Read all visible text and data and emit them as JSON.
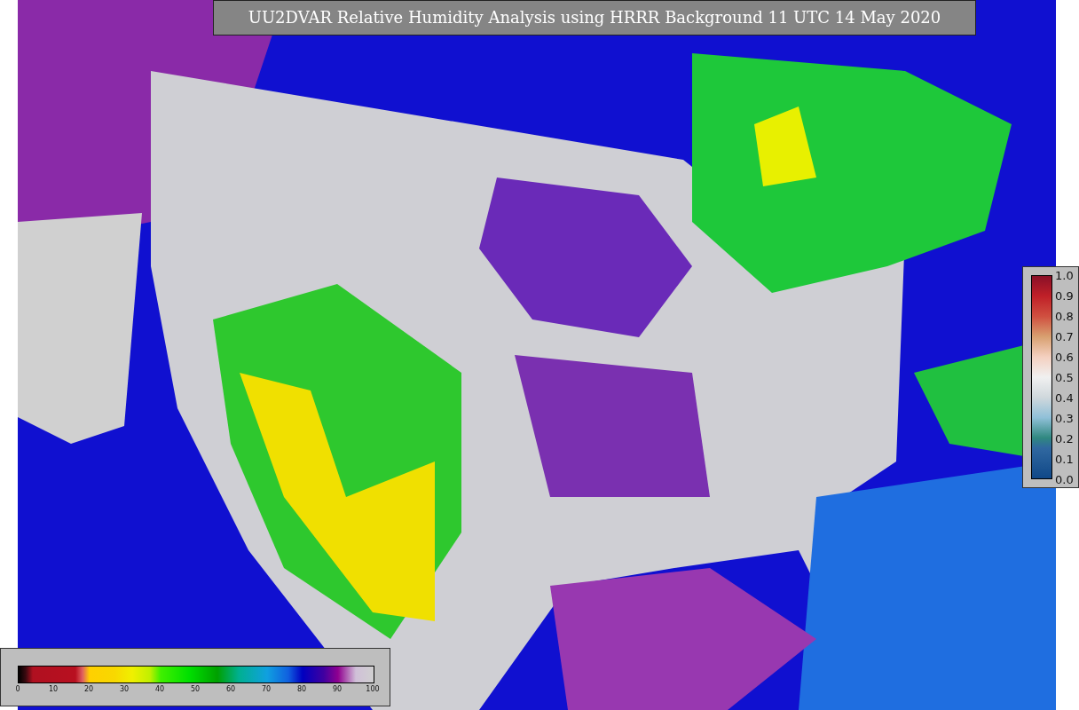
{
  "title": "UU2DVAR Relative Humidity Analysis using HRRR Background 11 UTC 14 May 2020",
  "humidity_colorbar": {
    "ticks": [
      "0",
      "10",
      "20",
      "30",
      "40",
      "50",
      "60",
      "70",
      "80",
      "90",
      "100"
    ]
  },
  "station_colorbar": {
    "ticks": [
      "1.0",
      "0.9",
      "0.8",
      "0.7",
      "0.6",
      "0.5",
      "0.4",
      "0.3",
      "0.2",
      "0.1",
      "0.0"
    ]
  }
}
